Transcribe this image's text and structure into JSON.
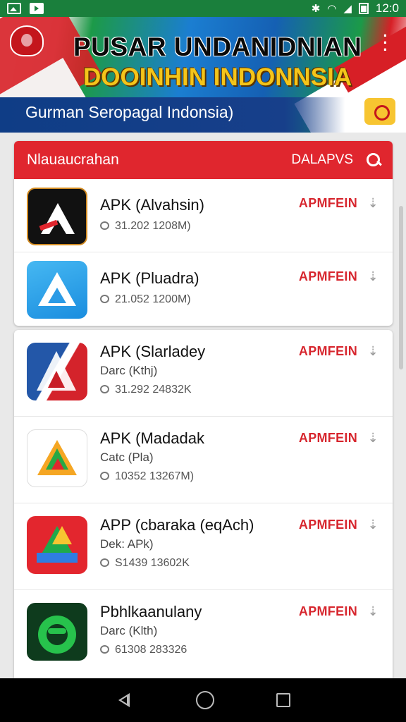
{
  "status_bar": {
    "time": "12:0",
    "icons": [
      "image-icon",
      "play-store-icon",
      "bluetooth-icon",
      "wifi-icon",
      "signal-icon",
      "battery-icon"
    ]
  },
  "banner": {
    "title": "PUSAR UNDANIDNIAN",
    "subtitle": "DOOINHIN INDONNSIA",
    "tagline": "Gurman Seropagal Indonsia)",
    "colors": {
      "red": "#d71f26",
      "green": "#1c9a48",
      "blue": "#1b7ed1",
      "gold": "#f4c51a"
    }
  },
  "list": {
    "header_title": "Nlauaucrahan",
    "header_action": "DALAPVS",
    "accent_color": "#e0262e",
    "featured": [
      {
        "name": "APK (Alvahsin)",
        "meta": "31.202 1208M)",
        "action": "APMFEIN",
        "icon": "apk-black-a-icon"
      },
      {
        "name": "APK (Pluadra)",
        "meta": "21.052 1200M)",
        "action": "APMFEIN",
        "icon": "apk-blue-a-icon"
      }
    ],
    "items": [
      {
        "name": "APK (Slarladey",
        "category": "Darc (Kthj)",
        "meta": "31.292 24832K",
        "action": "APMFEIN",
        "icon": "apk-flag-a-icon"
      },
      {
        "name": "APK (Madadak",
        "category": "Catc (Pla)",
        "meta": "10352 13267M)",
        "action": "APMFEIN",
        "icon": "apk-colorful-a-icon"
      },
      {
        "name": "APP (cbaraka (eqAch)",
        "category": "Dek: APk)",
        "meta": "S1439 13602K",
        "action": "APMFEIN",
        "icon": "apk-drive-icon"
      },
      {
        "name": "Pbhlkaanulany",
        "category": "Darc (Klth)",
        "meta": "61308 283326",
        "action": "APMFEIN",
        "icon": "apk-green-s-icon"
      }
    ]
  }
}
